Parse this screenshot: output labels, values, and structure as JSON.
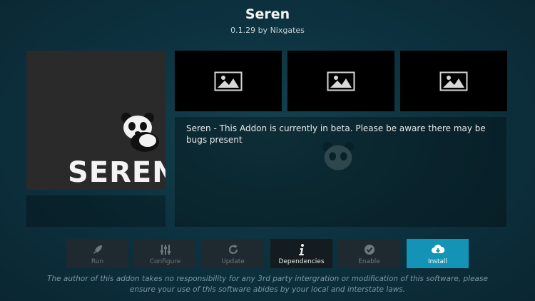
{
  "addon": {
    "name": "Seren",
    "version_line": "0.1.29 by Nixgates",
    "fanart_brand": "SEREN",
    "description": "Seren - This Addon is currently in beta. Please be aware there may be bugs present"
  },
  "screenshots": [
    {
      "icon": "image-placeholder-icon"
    },
    {
      "icon": "image-placeholder-icon"
    },
    {
      "icon": "image-placeholder-icon"
    }
  ],
  "actions": [
    {
      "label": "Run",
      "icon": "rocket-icon",
      "state": "disabled"
    },
    {
      "label": "Configure",
      "icon": "sliders-icon",
      "state": "disabled"
    },
    {
      "label": "Update",
      "icon": "refresh-icon",
      "state": "disabled"
    },
    {
      "label": "Dependencies",
      "icon": "info-icon",
      "state": "enabled"
    },
    {
      "label": "Enable",
      "icon": "check-circle-icon",
      "state": "disabled"
    },
    {
      "label": "Install",
      "icon": "cloud-download-icon",
      "state": "focused"
    }
  ],
  "disclaimer": "The author of this addon takes no responsibility for any 3rd party intergration or modification of this software, please ensure your use of this software abides by your local and interstate laws.",
  "colors": {
    "background": "#0d3340",
    "focus_accent": "#1393b5",
    "button_bg": "#1f2a30",
    "disabled_text": "#6e787d"
  }
}
